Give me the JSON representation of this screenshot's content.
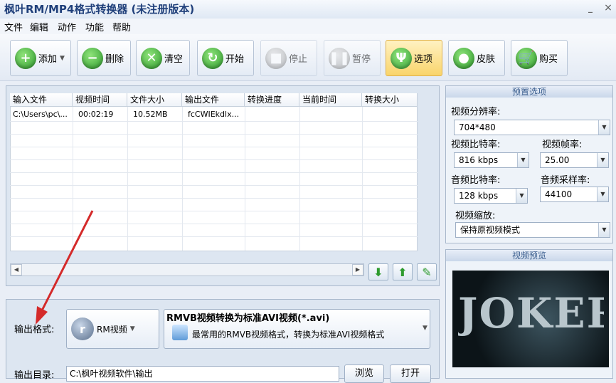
{
  "window": {
    "title": "枫叶RM/MP4格式转换器  (未注册版本)",
    "minimize_glyph": "_",
    "close_glyph": "×"
  },
  "menu": [
    "文件",
    "编辑",
    "动作",
    "功能",
    "帮助"
  ],
  "toolbar": {
    "add": "添加",
    "delete": "删除",
    "clear": "清空",
    "start": "开始",
    "stop": "停止",
    "pause": "暂停",
    "options": "选项",
    "skin": "皮肤",
    "buy": "购买"
  },
  "icons": {
    "add": "plus-icon",
    "delete": "minus-icon",
    "clear": "x-icon",
    "start": "refresh-icon",
    "stop": "stop-icon",
    "pause": "pause-icon",
    "options": "tools-icon",
    "skin": "apple-icon",
    "buy": "cart-icon"
  },
  "table": {
    "headers": [
      "输入文件",
      "视频时间",
      "文件大小",
      "输出文件",
      "转换进度",
      "当前时间",
      "转换大小"
    ],
    "rows": [
      [
        "C:\\Users\\pc\\...",
        "00:02:19",
        "10.52MB",
        "fcCWIEkdlx...",
        "",
        "",
        ""
      ]
    ]
  },
  "output": {
    "format_label": "输出格式:",
    "format_name": "RM视频",
    "format_title": "RMVB视频转换为标准AVI视频(*.avi)",
    "format_desc": "最常用的RMVB视频格式，转换为标准AVI视频格式",
    "dir_label": "输出目录:",
    "dir_value": "C:\\枫叶视频软件\\输出",
    "browse": "浏览",
    "open": "打开"
  },
  "preset": {
    "header": "预置选项",
    "resolution_label": "视频分辨率:",
    "resolution": "704*480",
    "vbitrate_label": "视频比特率:",
    "vbitrate": "816 kbps",
    "fps_label": "视频帧率:",
    "fps": "25.00",
    "abitrate_label": "音频比特率:",
    "abitrate": "128 kbps",
    "samplerate_label": "音频采样率:",
    "samplerate": "44100",
    "scale_label": "视频缩放:",
    "scale": "保持原视频模式"
  },
  "preview": {
    "header": "视频预览",
    "poster_text": "JOKER"
  },
  "colors": {
    "accent": "#3aa53a",
    "selected": "#f9d46b",
    "header_text": "#3c5f8f",
    "annotation_arrow": "#d42a2a"
  }
}
